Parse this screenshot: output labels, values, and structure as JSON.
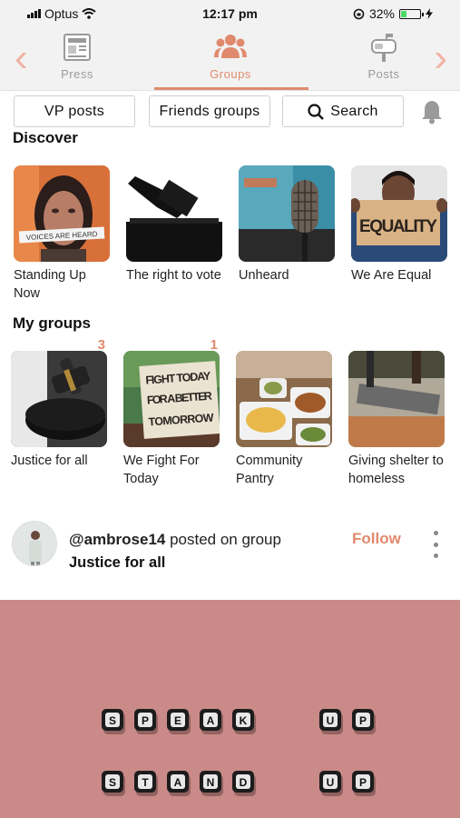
{
  "status_bar": {
    "carrier": "Optus",
    "time": "12:17 pm",
    "battery": "32%",
    "battery_level": 0.32
  },
  "top_nav": {
    "tabs": [
      {
        "label": "Press",
        "icon": "newspaper-icon"
      },
      {
        "label": "Groups",
        "icon": "people-icon",
        "active": true
      },
      {
        "label": "Posts",
        "icon": "mailbox-icon"
      }
    ]
  },
  "filters": {
    "vp_posts": "VP posts",
    "friends_groups": "Friends groups",
    "search": "Search"
  },
  "discover": {
    "title": "Discover",
    "items": [
      {
        "label": "Standing Up Now"
      },
      {
        "label": "The right to vote"
      },
      {
        "label": "Unheard"
      },
      {
        "label": "We Are Equal"
      }
    ]
  },
  "my_groups": {
    "title": "My groups",
    "items": [
      {
        "label": "Justice for all",
        "badge": "3"
      },
      {
        "label": "We Fight For Today",
        "badge": "1"
      },
      {
        "label": "Community Pantry",
        "badge": ""
      },
      {
        "label": "Giving shelter to homeless",
        "badge": ""
      }
    ]
  },
  "post": {
    "username": "@ambrose14",
    "action": " posted on group",
    "group": "Justice for all",
    "follow": "Follow"
  },
  "image_text": {
    "equality_sign": "EQUALITY",
    "fight_sign_1": "FIGHT TODAY",
    "fight_sign_2": "FOR A BETTER",
    "fight_sign_3": "TOMORROW",
    "tape_text": "VOICES ARE HEARD",
    "speak": "SPEAK UP",
    "stand": "STAND UP"
  },
  "colors": {
    "accent": "#e08a6d",
    "nav_bg": "#f2f2f2",
    "post_bg": "#c98a88"
  }
}
